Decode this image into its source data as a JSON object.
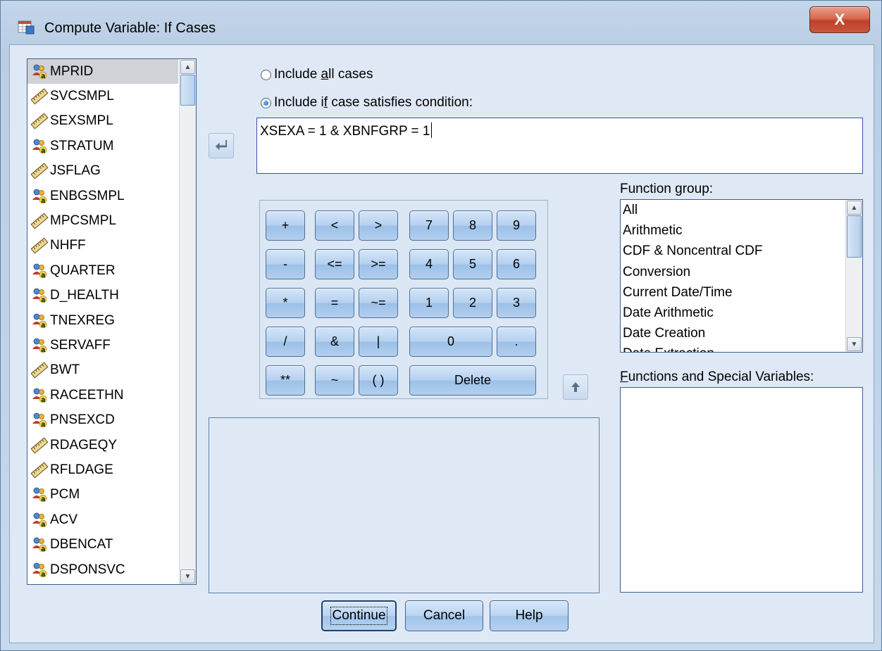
{
  "window": {
    "title": "Compute Variable: If Cases",
    "close_label": "X"
  },
  "variables": [
    {
      "name": "MPRID",
      "type": "nominal",
      "selected": true
    },
    {
      "name": "SVCSMPL",
      "type": "scale"
    },
    {
      "name": "SEXSMPL",
      "type": "scale"
    },
    {
      "name": "STRATUM",
      "type": "nominal"
    },
    {
      "name": "JSFLAG",
      "type": "scale"
    },
    {
      "name": "ENBGSMPL",
      "type": "nominal"
    },
    {
      "name": "MPCSMPL",
      "type": "scale"
    },
    {
      "name": "NHFF",
      "type": "scale"
    },
    {
      "name": "QUARTER",
      "type": "nominal"
    },
    {
      "name": "D_HEALTH",
      "type": "nominal"
    },
    {
      "name": "TNEXREG",
      "type": "nominal"
    },
    {
      "name": "SERVAFF",
      "type": "nominal"
    },
    {
      "name": "BWT",
      "type": "scale"
    },
    {
      "name": "RACEETHN",
      "type": "nominal"
    },
    {
      "name": "PNSEXCD",
      "type": "nominal"
    },
    {
      "name": "RDAGEQY",
      "type": "scale"
    },
    {
      "name": "RFLDAGE",
      "type": "scale"
    },
    {
      "name": "PCM",
      "type": "nominal"
    },
    {
      "name": "ACV",
      "type": "nominal"
    },
    {
      "name": "DBENCAT",
      "type": "nominal"
    },
    {
      "name": "DSPONSVC",
      "type": "nominal"
    }
  ],
  "options": {
    "all_cases": {
      "pre": "Include ",
      "accel": "a",
      "post": "ll cases",
      "selected": false
    },
    "if_condition": {
      "pre": "Include i",
      "accel": "f",
      "post": " case satisfies condition:",
      "selected": true
    }
  },
  "expression": "XSEXA = 1 & XBNFGRP = 1",
  "keypad": [
    "+",
    "<",
    ">",
    "7",
    "8",
    "9",
    "-",
    "<=",
    ">=",
    "4",
    "5",
    "6",
    "*",
    "=",
    "~=",
    "1",
    "2",
    "3",
    "/",
    "&",
    "|",
    "0",
    ".",
    "**",
    "~",
    "( )",
    "Delete"
  ],
  "function_group": {
    "label_pre": "Function ",
    "label_accel": "g",
    "label_post": "roup:",
    "items": [
      "All",
      "Arithmetic",
      "CDF & Noncentral CDF",
      "Conversion",
      "Current Date/Time",
      "Date Arithmetic",
      "Date Creation",
      "Date Extraction"
    ]
  },
  "functions_label": {
    "accel": "F",
    "post": "unctions and Special Variables:"
  },
  "buttons": {
    "continue": "Continue",
    "cancel": "Cancel",
    "help": "Help"
  }
}
